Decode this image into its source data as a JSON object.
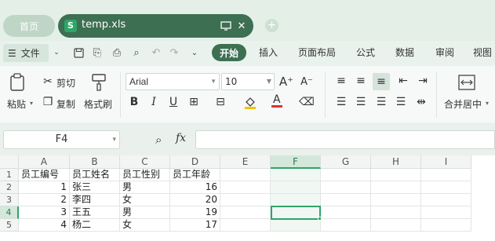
{
  "tabs": {
    "home_label": "首页",
    "file_label": "temp.xls"
  },
  "menu": {
    "file_label": "文件",
    "items": [
      "开始",
      "插入",
      "页面布局",
      "公式",
      "数据",
      "审阅",
      "视图"
    ]
  },
  "ribbon": {
    "paste": "粘贴",
    "cut": "剪切",
    "copy": "复制",
    "format_painter": "格式刷",
    "font_name": "Arial",
    "font_size": "10",
    "bold": "B",
    "italic": "I",
    "underline": "U",
    "merge": "合并居中"
  },
  "formula_bar": {
    "name_box": "F4",
    "fx": "fx",
    "formula": ""
  },
  "sheet": {
    "columns": [
      "A",
      "B",
      "C",
      "D",
      "E",
      "F",
      "G",
      "H",
      "I"
    ],
    "rows": [
      "1",
      "2",
      "3",
      "4",
      "5"
    ],
    "active_col": "F",
    "active_row": "4",
    "cells": [
      [
        "员工编号",
        "员工姓名",
        "员工性别",
        "员工年龄"
      ],
      [
        "1",
        "张三",
        "男",
        "16"
      ],
      [
        "2",
        "李四",
        "女",
        "20"
      ],
      [
        "3",
        "王五",
        "男",
        "19"
      ],
      [
        "4",
        "杨二",
        "女",
        "17"
      ]
    ]
  },
  "colors": {
    "accent": "#3d6f52",
    "select": "#2fa56a"
  }
}
